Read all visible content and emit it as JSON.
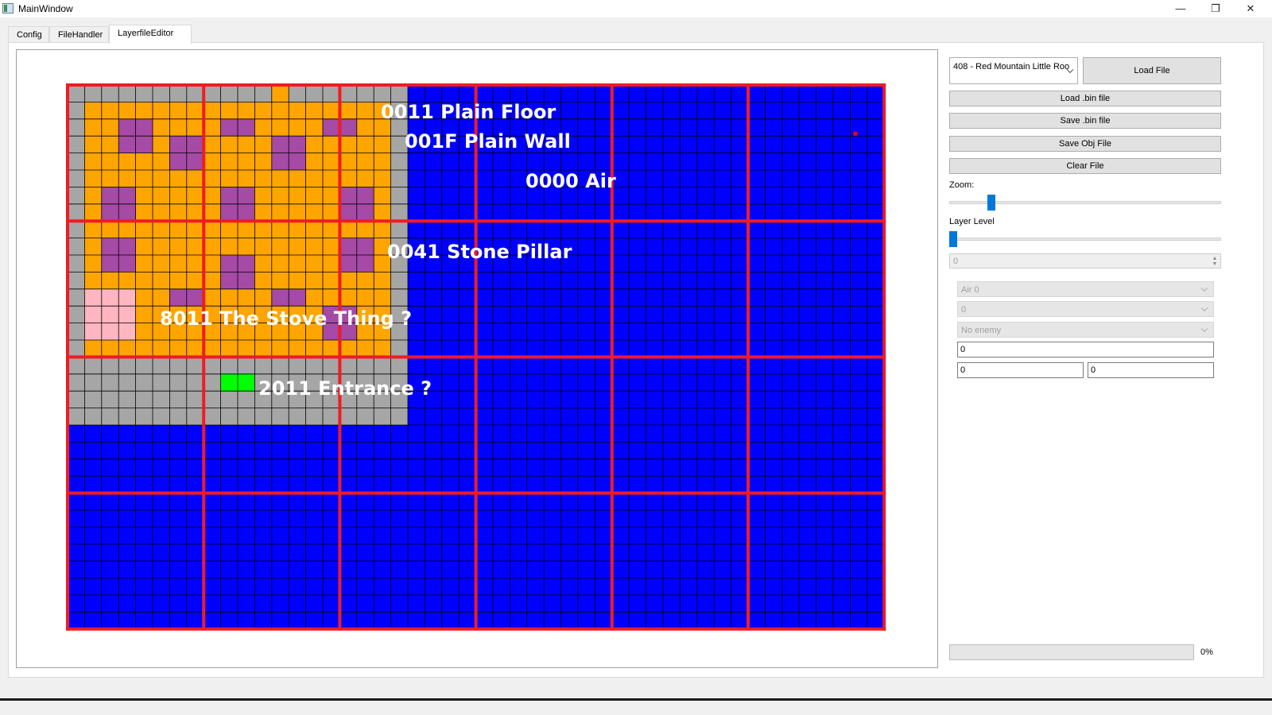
{
  "window": {
    "title": "MainWindow",
    "minimize_glyph": "—",
    "maximize_glyph": "❐",
    "close_glyph": "✕"
  },
  "tabs": [
    {
      "label": "Config",
      "active": false
    },
    {
      "label": "FileHandler",
      "active": false
    },
    {
      "label": "LayerfileEditor",
      "active": true
    }
  ],
  "map": {
    "colors": {
      "air": "#0000ff",
      "wall": "#a6a6a6",
      "floor": "#ffa500",
      "pillar": "#a54aa5",
      "stove": "#ffb6c1",
      "entrance": "#00ff00",
      "grid_line": "#000000",
      "chunk_line": "#ee1c24",
      "marker": "#ff0000"
    },
    "labels": [
      {
        "text": "0011 Plain Floor"
      },
      {
        "text": "001F Plain Wall"
      },
      {
        "text": "0000 Air"
      },
      {
        "text": "0041 Stone Pillar"
      },
      {
        "text": "8011 The Stove Thing ?"
      },
      {
        "text": "2011 Entrance ?"
      }
    ]
  },
  "panel": {
    "file_select": "408 - Red Mountain Little Roo",
    "load_file": "Load File",
    "load_bin": "Load .bin file",
    "save_bin": "Save .bin file",
    "save_obj": "Save Obj File",
    "clear_file": "Clear File",
    "zoom_label": "Zoom:",
    "zoom_value": 0.14,
    "layer_label": "Layer Level",
    "layer_value": 0,
    "layer_spin": "0",
    "tile_type": "Air 0",
    "param_select": "0",
    "enemy_select": "No enemy",
    "field_a": "0",
    "field_b": "0",
    "field_c": "0"
  },
  "progress": {
    "value": 0,
    "text": "0%"
  }
}
